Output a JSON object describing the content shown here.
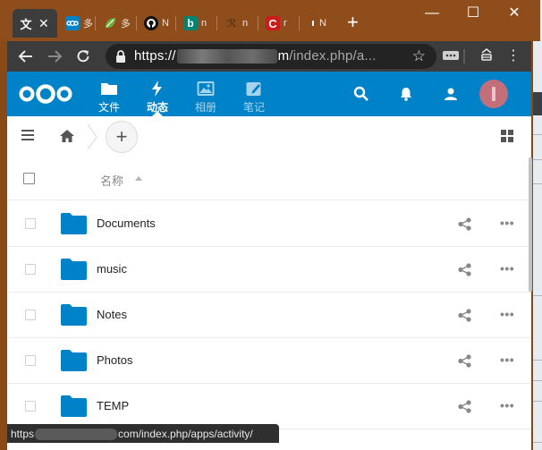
{
  "browser": {
    "tabs": [
      {
        "icon": "translate-favicon",
        "title": "文",
        "color": "#ffffff"
      },
      {
        "icon": "nextcloud-favicon",
        "title": "多",
        "color": "#0082c9"
      },
      {
        "icon": "spring-favicon",
        "title": "多",
        "color": "#6db33f"
      },
      {
        "icon": "github-favicon",
        "title": "N",
        "color": "#111111"
      },
      {
        "icon": "bing-favicon",
        "title": "n",
        "color": "#008373"
      },
      {
        "icon": "generic-favicon",
        "title": "n",
        "color": "#6a3c1a"
      },
      {
        "icon": "c-favicon",
        "title": "r",
        "color": "#cc1b1b"
      },
      {
        "icon": "blank-favicon",
        "title": "N",
        "color": "#8e4d1b"
      }
    ],
    "url_scheme": "https://",
    "url_prefix": "",
    "url_host_end": "m",
    "url_path": "/index.php/a...",
    "new_tab_glyph": "+"
  },
  "nc": {
    "nav": [
      {
        "label": "文件",
        "icon": "folder-icon",
        "state": "normal"
      },
      {
        "label": "动态",
        "icon": "lightning-icon",
        "state": "active"
      },
      {
        "label": "相册",
        "icon": "image-icon",
        "state": "dim"
      },
      {
        "label": "笔记",
        "icon": "pencil-icon",
        "state": "dim"
      }
    ]
  },
  "files": {
    "column_name": "名称",
    "rows": [
      {
        "name": "Documents"
      },
      {
        "name": "music"
      },
      {
        "name": "Notes"
      },
      {
        "name": "Photos"
      },
      {
        "name": "TEMP"
      }
    ],
    "more_glyph": "•••",
    "add_glyph": "+"
  },
  "status": {
    "prefix": "https",
    "suffix": "com/index.php/apps/activity/"
  },
  "colors": {
    "header": "#0082c9",
    "folder": "#0082c9",
    "titlebar": "#8e4d1b",
    "avatar": "#c36f7b"
  }
}
